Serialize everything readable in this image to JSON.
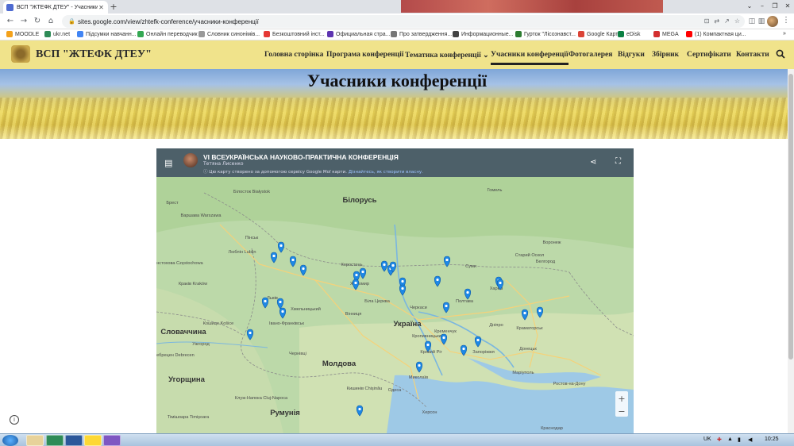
{
  "browser": {
    "tab_title": "ВСП \"ЖТЕФК ДТЕУ\" - Учасники к",
    "new_tab": "+",
    "url": "sites.google.com/view/zhtefk-conference/учасники-конференції"
  },
  "bookmarks": [
    {
      "label": "MOODLE",
      "color": "#f4a21b"
    },
    {
      "label": "ukr.net",
      "color": "#2e8b57"
    },
    {
      "label": "Підсумки навчанн...",
      "color": "#4285f4"
    },
    {
      "label": "Онлайн переводчик",
      "color": "#34a853"
    },
    {
      "label": "Словник синонімів...",
      "color": "#999999"
    },
    {
      "label": "Безкоштовний інст...",
      "color": "#e53935"
    },
    {
      "label": "Официальная стра...",
      "color": "#5e35b1"
    },
    {
      "label": "Про затвердження...",
      "color": "#777777"
    },
    {
      "label": "Информационные...",
      "color": "#444444"
    },
    {
      "label": "Гурток \"Лісознавст...",
      "color": "#2e7d32"
    },
    {
      "label": "Google Карты",
      "color": "#db4437"
    },
    {
      "label": "eDisk",
      "color": "#0b8043"
    },
    {
      "label": "MEGA",
      "color": "#d32f2f"
    },
    {
      "label": "(1) Компактная ци...",
      "color": "#ff0000"
    }
  ],
  "site": {
    "title": "ВСП \"ЖТЕФК ДТЕУ\"",
    "nav": [
      "Головна сторінка",
      "Програма конференції",
      "Тематика конференції",
      "Учасники конференції",
      "Фотогалерея",
      "Відгуки",
      "Збірник",
      "Сертифікати",
      "Контакти"
    ],
    "dropdown_indicator": "⌄",
    "page_heading": "Учасники конференції"
  },
  "map": {
    "title": "VI ВСЕУКРАЇНСЬКА НАУКОВО-ПРАКТИЧНА КОНФЕРЕНЦІЯ",
    "author": "Тетяна Лисенко",
    "info_text": "Цю карту створено за допомогою сервісу Google Мої карти.",
    "info_link": "Дізнайтесь, як створити власну.",
    "labels": [
      {
        "text": "Білорусь",
        "big": true
      },
      {
        "text": "Україна",
        "big": true
      },
      {
        "text": "Молдова",
        "big": true
      },
      {
        "text": "Словаччина",
        "big": true
      },
      {
        "text": "Угорщина",
        "big": true
      },
      {
        "text": "Румунія",
        "big": true
      },
      {
        "text": "Воронеж",
        "big": false
      },
      {
        "text": "Білосток Białystok",
        "big": false
      },
      {
        "text": "Варшава Warszawa",
        "big": false
      },
      {
        "text": "Люблін Lublin",
        "big": false
      },
      {
        "text": "Ченстохова Częstochowa",
        "big": false
      },
      {
        "text": "Краків Kraków",
        "big": false
      },
      {
        "text": "Кошице Košice",
        "big": false
      },
      {
        "text": "Дебрецен Debrecen",
        "big": false
      },
      {
        "text": "Клуж-Напока Cluj-Napoca",
        "big": false
      },
      {
        "text": "Кишинів Chișinău",
        "big": false
      },
      {
        "text": "Одеса",
        "big": false
      },
      {
        "text": "Дніпро",
        "big": false
      },
      {
        "text": "Харків",
        "big": false
      },
      {
        "text": "Полтава",
        "big": false
      },
      {
        "text": "Кременчук",
        "big": false
      },
      {
        "text": "Миколаїв",
        "big": false
      },
      {
        "text": "Херсон",
        "big": false
      },
      {
        "text": "Запоріжжя",
        "big": false
      },
      {
        "text": "Кривий Ріг",
        "big": false
      },
      {
        "text": "Маріуполь",
        "big": false
      },
      {
        "text": "Донецьк",
        "big": false
      },
      {
        "text": "Ростов-на-Дону",
        "big": false
      },
      {
        "text": "Краснодар",
        "big": false
      },
      {
        "text": "Белгород",
        "big": false
      },
      {
        "text": "Житомир",
        "big": false
      },
      {
        "text": "Біла Церква",
        "big": false
      },
      {
        "text": "Вінниця",
        "big": false
      },
      {
        "text": "Хмельницький",
        "big": false
      },
      {
        "text": "Львів",
        "big": false
      },
      {
        "text": "Івано-Франківськ",
        "big": false
      },
      {
        "text": "Чернівці",
        "big": false
      },
      {
        "text": "Ужгород",
        "big": false
      },
      {
        "text": "Черкаси",
        "big": false
      },
      {
        "text": "Суми",
        "big": false
      },
      {
        "text": "Гомель",
        "big": false
      },
      {
        "text": "Брест",
        "big": false
      },
      {
        "text": "Пінськ",
        "big": false
      },
      {
        "text": "Коростень",
        "big": false
      },
      {
        "text": "Кропивницький",
        "big": false
      },
      {
        "text": "Краматорськ",
        "big": false
      },
      {
        "text": "Старий Оскол",
        "big": false
      },
      {
        "text": "Тімішоара Timișoara",
        "big": false
      }
    ],
    "pin_color": "#1e88e5"
  },
  "taskbar": {
    "lang": "UK",
    "time": "10:25"
  }
}
